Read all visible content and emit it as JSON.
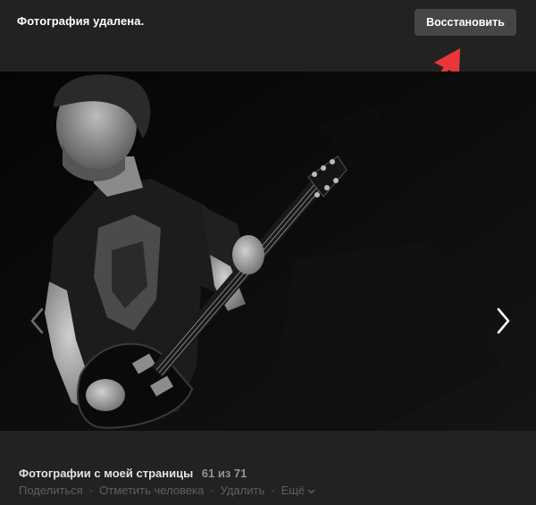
{
  "header": {
    "status_text": "Фотография удалена.",
    "restore_label": "Восстановить"
  },
  "viewer": {
    "prev_icon": "chevron-left-icon",
    "next_icon": "chevron-right-icon",
    "annotation_arrow_color": "#e8363a"
  },
  "footer": {
    "album_title": "Фотографии с моей страницы",
    "counter": "61 из 71",
    "actions": {
      "share": "Поделиться",
      "tag": "Отметить человека",
      "delete": "Удалить",
      "more": "Ещё"
    },
    "separator": "·"
  }
}
